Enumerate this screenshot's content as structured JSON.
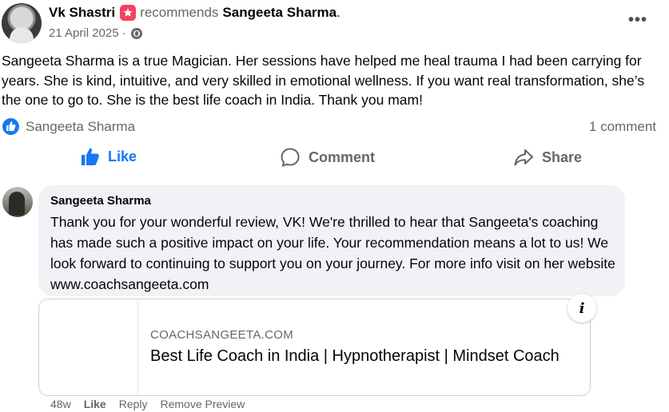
{
  "post": {
    "author": "Vk Shastri",
    "recommends_text": "recommends",
    "recommended_name": "Sangeeta Sharma",
    "date": "21 April 2025",
    "date_sep": "·",
    "privacy_icon": "globe-icon",
    "more_label": "•••",
    "body": "Sangeeta Sharma is a true Magician. Her sessions have helped me heal trauma I had been carrying for years. She is kind, intuitive, and very skilled in emotional wellness. If you want real transformation, she’s the one to go to. She is the best life coach in India. Thank you mam!"
  },
  "reactions": {
    "icon": "like-icon",
    "reactor_name": "Sangeeta Sharma",
    "comment_count": "1 comment"
  },
  "actions": {
    "like": "Like",
    "comment": "Comment",
    "share": "Share"
  },
  "comment": {
    "author": "Sangeeta Sharma",
    "text": "Thank you for your wonderful review, VK! We're thrilled to hear that Sangeeta's coaching has made such a positive impact on your life. Your recommendation means a lot to us! We look forward to continuing to support you on your journey. For more info visit on her website www.coachsangeeta.com",
    "preview": {
      "domain": "COACHSANGEETA.COM",
      "title": "Best Life Coach in India | Hypnotherapist | Mindset Coach",
      "info_label": "i"
    },
    "footer": {
      "age": "48w",
      "like": "Like",
      "reply": "Reply",
      "remove_preview": "Remove Preview"
    }
  },
  "colors": {
    "accent": "#1877f2",
    "recommend_badge": "#f3425f",
    "secondary_text": "#65676b",
    "bubble_bg": "#f0f2f5"
  }
}
